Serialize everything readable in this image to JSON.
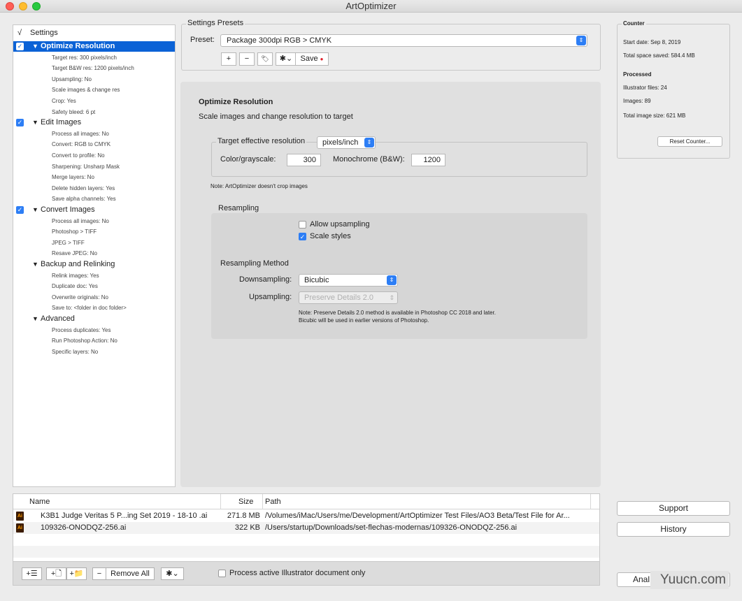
{
  "window": {
    "title": "ArtOptimizer"
  },
  "tree": {
    "header_check": "√",
    "header_label": "Settings",
    "rows": [
      {
        "kind": "cat",
        "label": "Optimize Resolution",
        "checked": true,
        "selected": true
      },
      {
        "kind": "sub",
        "label": "Target res: 300 pixels/inch"
      },
      {
        "kind": "sub",
        "label": "Target B&W res: 1200 pixels/inch"
      },
      {
        "kind": "sub",
        "label": "Upsampling: No"
      },
      {
        "kind": "sub",
        "label": "Scale images & change res"
      },
      {
        "kind": "sub",
        "label": "Crop: Yes"
      },
      {
        "kind": "sub",
        "label": "Safety bleed: 6 pt"
      },
      {
        "kind": "cat",
        "label": "Edit Images",
        "checked": true
      },
      {
        "kind": "sub",
        "label": "Process all images: No"
      },
      {
        "kind": "sub",
        "label": "Convert: RGB to CMYK"
      },
      {
        "kind": "sub",
        "label": "Convert to profile: No"
      },
      {
        "kind": "sub",
        "label": "Sharpening: Unsharp Mask"
      },
      {
        "kind": "sub",
        "label": "Merge layers: No"
      },
      {
        "kind": "sub",
        "label": "Delete hidden layers: Yes"
      },
      {
        "kind": "sub",
        "label": "Save alpha channels: Yes"
      },
      {
        "kind": "cat",
        "label": "Convert Images",
        "checked": true
      },
      {
        "kind": "sub",
        "label": "Process all images: No"
      },
      {
        "kind": "sub",
        "label": "Photoshop > TIFF"
      },
      {
        "kind": "sub",
        "label": "JPEG > TIFF"
      },
      {
        "kind": "sub",
        "label": "Resave JPEG: No"
      },
      {
        "kind": "cat",
        "label": "Backup and Relinking",
        "checked": false
      },
      {
        "kind": "sub",
        "label": "Relink images: Yes"
      },
      {
        "kind": "sub",
        "label": "Duplicate doc: Yes"
      },
      {
        "kind": "sub",
        "label": "Overwrite originals: No"
      },
      {
        "kind": "sub",
        "label": "Save to: <folder in doc folder>"
      },
      {
        "kind": "cat",
        "label": "Advanced",
        "checked": false
      },
      {
        "kind": "sub",
        "label": "Process duplicates: Yes"
      },
      {
        "kind": "sub",
        "label": "Run Photoshop Action: No"
      },
      {
        "kind": "sub",
        "label": "Specific layers: No"
      }
    ]
  },
  "presets": {
    "group_label": "Settings Presets",
    "preset_label": "Preset:",
    "preset_value": "Package 300dpi RGB > CMYK",
    "add_glyph": "+",
    "remove_glyph": "−",
    "tag_glyph": "🏷",
    "gear_glyph": "✱⌄",
    "save_label": "Save",
    "save_dot": "●"
  },
  "main": {
    "title": "Optimize Resolution",
    "subtitle": "Scale images and change resolution to target",
    "target_label": "Target effective resolution",
    "unit_value": "pixels/inch",
    "color_label": "Color/grayscale:",
    "color_value": "300",
    "mono_label": "Monochrome (B&W):",
    "mono_value": "1200",
    "crop_note": "Note: ArtOptimizer doesn't crop images",
    "resampling_label": "Resampling",
    "allow_upsampling": "Allow upsampling",
    "scale_styles": "Scale styles",
    "check_mark": "✓",
    "method_label": "Resampling Method",
    "down_label": "Downsampling:",
    "down_value": "Bicubic",
    "up_label": "Upsampling:",
    "up_value": "Preserve Details 2.0",
    "note_line1": "Note: Preserve Details 2.0 method is available in Photoshop CC 2018 and later.",
    "note_line2": "Bicubic will be used in earlier versions of Photoshop."
  },
  "counter": {
    "title": "Counter",
    "start_date": "Start date: Sep 8, 2019",
    "space_saved": "Total space saved:  584.4 MB",
    "processed_title": "Processed",
    "illustrator_files": "Illustrator files: 24",
    "images": "Images: 89",
    "total_image_size": "Total image size: 621 MB",
    "reset_label": "Reset Counter..."
  },
  "side_buttons": {
    "support": "Support",
    "history": "History",
    "analyze": "Anal"
  },
  "files": {
    "columns": [
      "Name",
      "Size",
      "Path"
    ],
    "rows": [
      {
        "icon": "Ai",
        "name": "K3B1 Judge Veritas 5 P...ing Set 2019 - 18-10 .ai",
        "size": "271.8 MB",
        "path": "/Volumes/iMac/Users/me/Development/ArtOptimizer Test Files/AO3 Beta/Test File for Ar..."
      },
      {
        "icon": "Ai",
        "name": "109326-ONODQZ-256.ai",
        "size": "322 KB",
        "path": "/Users/startup/Downloads/set-flechas-modernas/109326-ONODQZ-256.ai"
      }
    ]
  },
  "bottom": {
    "add_list_glyph": "+☰",
    "add_doc_glyph": "+🗋",
    "add_folder_glyph": "+📁",
    "remove_glyph": "−",
    "remove_all": "Remove All",
    "gear_glyph": "✱⌄",
    "active_only": "Process active Illustrator document only"
  },
  "watermark": "Yuucn.com"
}
